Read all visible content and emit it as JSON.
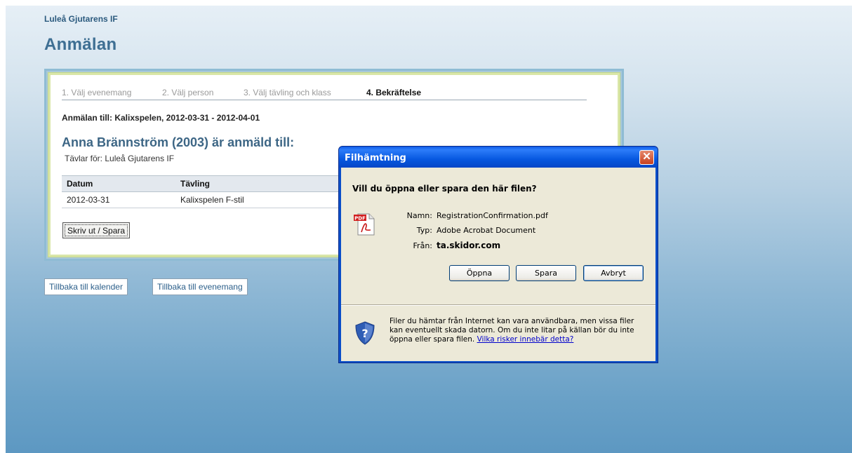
{
  "org_name": "Luleå Gjutarens IF",
  "page_title": "Anmälan",
  "steps": [
    {
      "label": "1. Välj evenemang"
    },
    {
      "label": "2. Välj person"
    },
    {
      "label": "3. Välj tävling och klass"
    },
    {
      "label": "4. Bekräftelse"
    }
  ],
  "registration_text": "Anmälan till:  Kalixspelen, 2012-03-31 - 2012-04-01",
  "person_heading": "Anna Brännström (2003) är anmäld till:",
  "competes_for": "Tävlar för:  Luleå Gjutarens IF",
  "table": {
    "headers": [
      "Datum",
      "Tävling"
    ],
    "rows": [
      [
        "2012-03-31",
        "Kalixspelen F-stil"
      ]
    ]
  },
  "print_button": "Skriv ut / Spara",
  "back_calendar": "Tillbaka till kalender",
  "back_events": "Tillbaka till evenemang",
  "dialog": {
    "title": "Filhämtning",
    "close_symbol": "✕",
    "question": "Vill du öppna eller spara den här filen?",
    "name_label": "Namn:",
    "name_value": "RegistrationConfirmation.pdf",
    "type_label": "Typ:",
    "type_value": "Adobe Acrobat Document",
    "from_label": "Från:",
    "from_value": "ta.skidor.com",
    "open_button": "Öppna",
    "save_button": "Spara",
    "cancel_button": "Avbryt",
    "warning_text": "Filer du hämtar från Internet kan vara användbara, men vissa filer kan eventuellt skada datorn. Om du inte litar på källan bör du inte öppna eller spara filen.",
    "warning_link": "Vilka risker innebär detta?",
    "pdf_icon_text": "PDF",
    "shield_symbol": "?"
  }
}
